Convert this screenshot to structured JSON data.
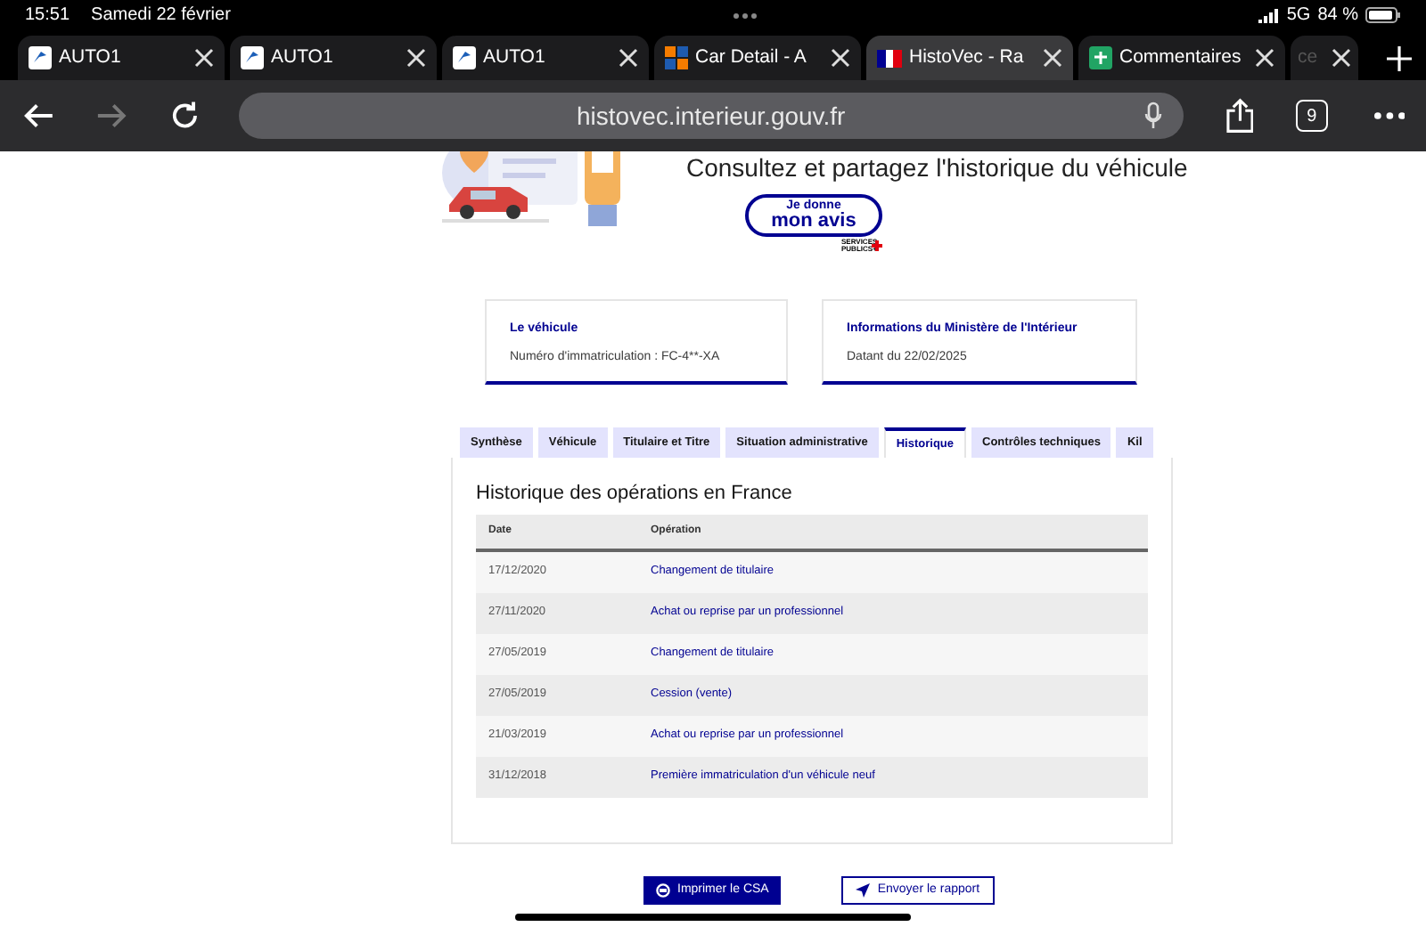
{
  "status_bar": {
    "time": "15:51",
    "date": "Samedi 22 février",
    "network": "5G",
    "battery": "84 %"
  },
  "browser_tabs": [
    {
      "title": "AUTO1",
      "kind": "auto1",
      "selected": false
    },
    {
      "title": "AUTO1",
      "kind": "auto1",
      "selected": false
    },
    {
      "title": "AUTO1",
      "kind": "auto1",
      "selected": false
    },
    {
      "title": "Car Detail - A",
      "kind": "squares",
      "selected": false
    },
    {
      "title": "HistoVec - Ra",
      "kind": "flag",
      "selected": true
    },
    {
      "title": "Commentaires",
      "kind": "sheet",
      "selected": false
    },
    {
      "title": "ce",
      "kind": "stacked",
      "selected": false
    }
  ],
  "toolbar": {
    "url": "histovec.interieur.gouv.fr",
    "tab_count": "9"
  },
  "hero": {
    "heading": "Consultez et partagez l'historique du véhicule",
    "feedback_line1": "Je donne",
    "feedback_line2": "mon avis",
    "feedback_logo": "SERVICES PUBLICS+"
  },
  "cards": [
    {
      "title": "Le véhicule",
      "text": "Numéro d'immatriculation : FC-4**-XA"
    },
    {
      "title": "Informations du Ministère de l'Intérieur",
      "text": "Datant du 22/02/2025"
    }
  ],
  "tabs": [
    {
      "label": "Synthèse",
      "selected": false
    },
    {
      "label": "Véhicule",
      "selected": false
    },
    {
      "label": "Titulaire et Titre",
      "selected": false
    },
    {
      "label": "Situation administrative",
      "selected": false
    },
    {
      "label": "Historique",
      "selected": true
    },
    {
      "label": "Contrôles techniques",
      "selected": false
    },
    {
      "label": "Kil",
      "selected": false
    }
  ],
  "table": {
    "title": "Historique des opérations en France",
    "columns": [
      "Date",
      "Opération"
    ],
    "rows": [
      [
        "17/12/2020",
        "Changement de titulaire"
      ],
      [
        "27/11/2020",
        "Achat ou reprise par un professionnel"
      ],
      [
        "27/05/2019",
        "Changement de titulaire"
      ],
      [
        "27/05/2019",
        "Cession (vente)"
      ],
      [
        "21/03/2019",
        "Achat ou reprise par un professionnel"
      ],
      [
        "31/12/2018",
        "Première immatriculation d'un véhicule neuf"
      ]
    ]
  },
  "actions": [
    {
      "label": "Imprimer le CSA",
      "kind": "primary"
    },
    {
      "label": "Envoyer le rapport",
      "kind": "secondary"
    }
  ]
}
